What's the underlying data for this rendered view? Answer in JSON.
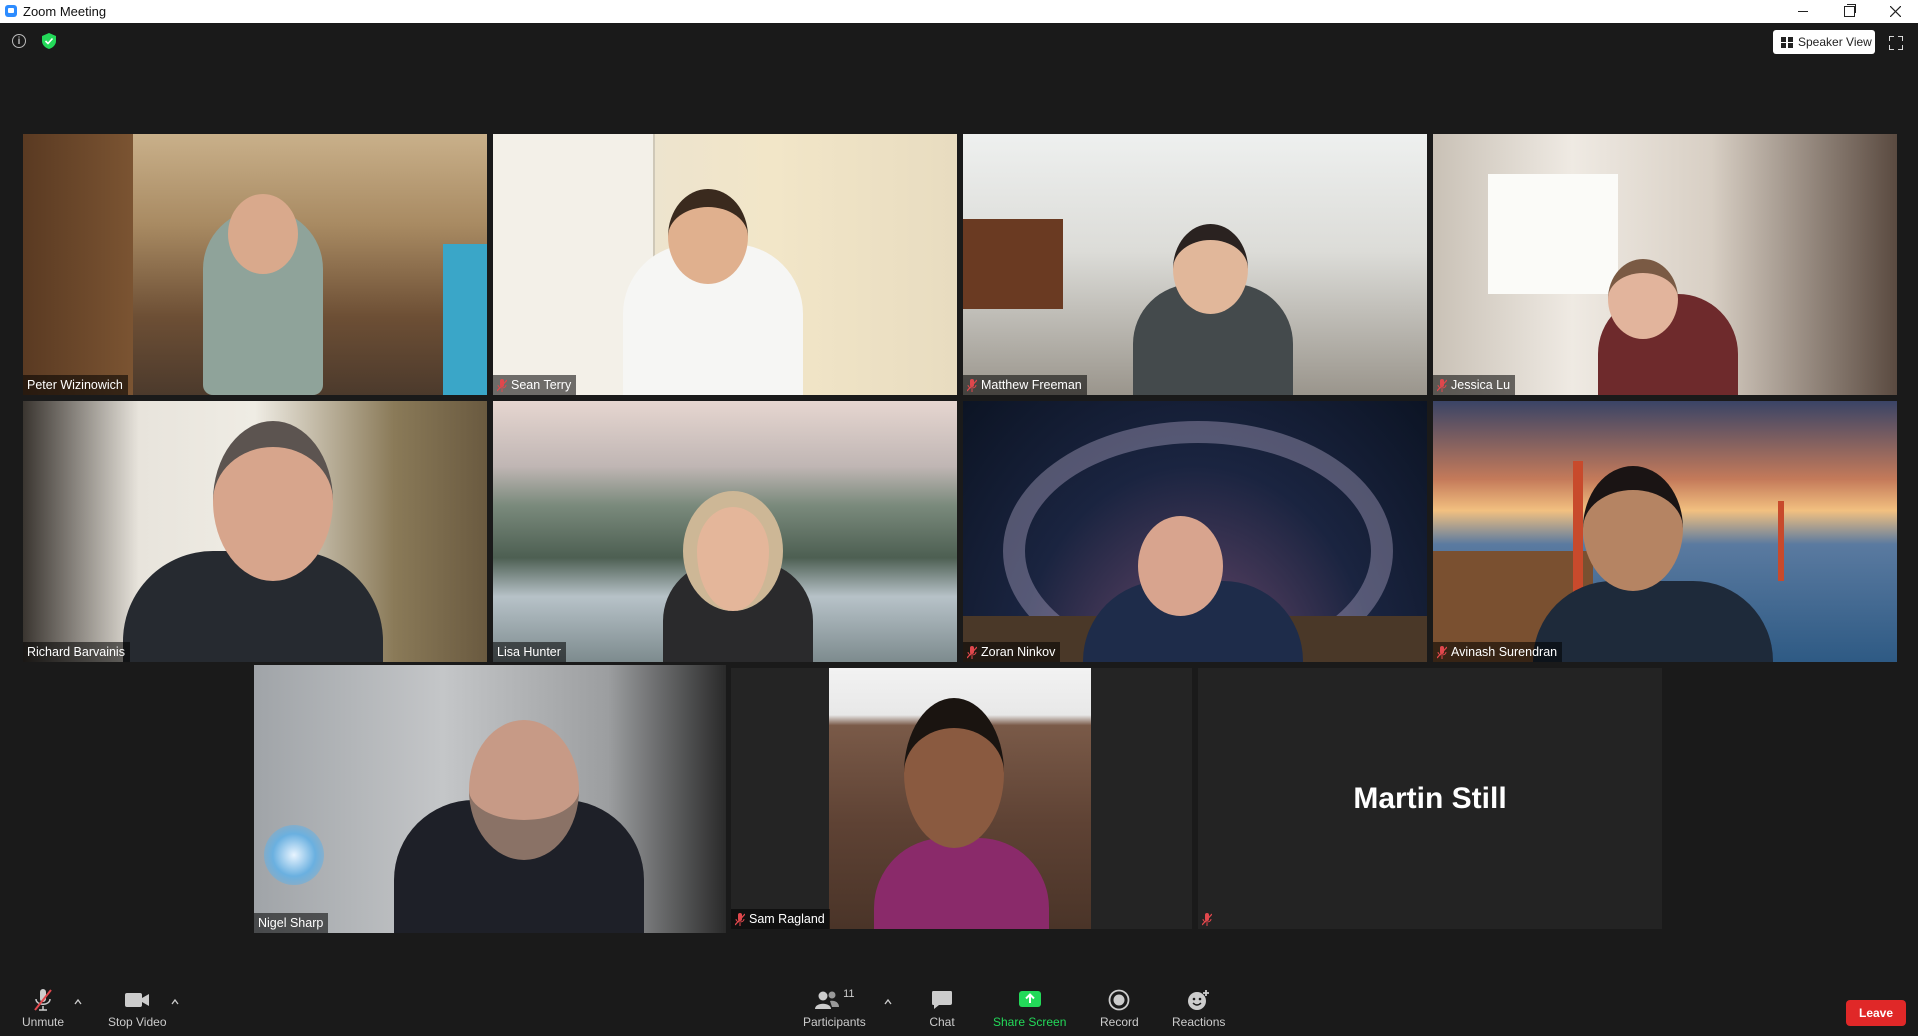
{
  "window": {
    "title": "Zoom Meeting"
  },
  "top_right": {
    "view_label": "Speaker View"
  },
  "participants": [
    {
      "name": "Peter Wizinowich",
      "muted": false
    },
    {
      "name": "Sean Terry",
      "muted": true
    },
    {
      "name": "Matthew Freeman",
      "muted": true
    },
    {
      "name": "Jessica Lu",
      "muted": true
    },
    {
      "name": "Richard Barvainis",
      "muted": false
    },
    {
      "name": "Lisa Hunter",
      "muted": false
    },
    {
      "name": "Zoran Ninkov",
      "muted": true
    },
    {
      "name": "Avinash Surendran",
      "muted": true
    },
    {
      "name": "Nigel Sharp",
      "muted": false,
      "speaking": true
    },
    {
      "name": "Sam Ragland",
      "muted": true
    },
    {
      "name": "",
      "muted": true,
      "display_name": "Martin Still"
    }
  ],
  "toolbar": {
    "unmute_label": "Unmute",
    "stop_video_label": "Stop Video",
    "participants_label": "Participants",
    "participants_count": "11",
    "chat_label": "Chat",
    "share_screen_label": "Share Screen",
    "record_label": "Record",
    "reactions_label": "Reactions",
    "leave_label": "Leave"
  },
  "colors": {
    "background": "#1a1a1a",
    "speaking_outline": "#d8e35a",
    "share_green": "#23d959",
    "leave_red": "#e02828",
    "muted_red": "#e0474c"
  }
}
